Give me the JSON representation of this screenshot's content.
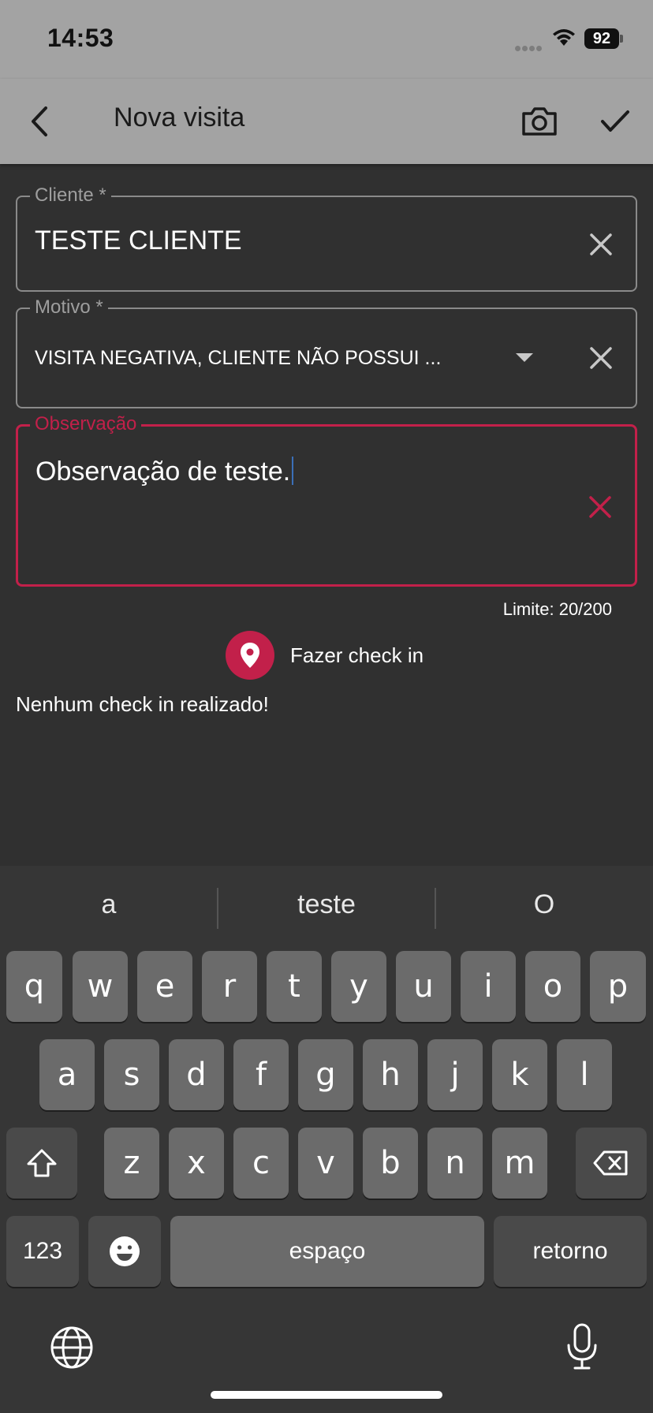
{
  "status_bar": {
    "time": "14:53",
    "battery": "92"
  },
  "app_bar": {
    "title": "Nova visita"
  },
  "form": {
    "cliente": {
      "label": "Cliente *",
      "value": "TESTE CLIENTE"
    },
    "motivo": {
      "label": "Motivo *",
      "value": "VISITA NEGATIVA, CLIENTE NÃO POSSUI ..."
    },
    "observacao": {
      "label": "Observação",
      "value": "Observação de teste."
    },
    "counter": "Limite: 20/200"
  },
  "checkin": {
    "button_label": "Fazer check in",
    "status": "Nenhum check in realizado!"
  },
  "keyboard": {
    "suggestions": [
      "a",
      "teste",
      "O"
    ],
    "row1": [
      "q",
      "w",
      "e",
      "r",
      "t",
      "y",
      "u",
      "i",
      "o",
      "p"
    ],
    "row2": [
      "a",
      "s",
      "d",
      "f",
      "g",
      "h",
      "j",
      "k",
      "l"
    ],
    "row3": [
      "z",
      "x",
      "c",
      "v",
      "b",
      "n",
      "m"
    ],
    "numbers_label": "123",
    "space_label": "espaço",
    "return_label": "retorno"
  },
  "colors": {
    "accent": "#c2204a",
    "app_bar": "#a3a3a3",
    "background": "#303030"
  }
}
